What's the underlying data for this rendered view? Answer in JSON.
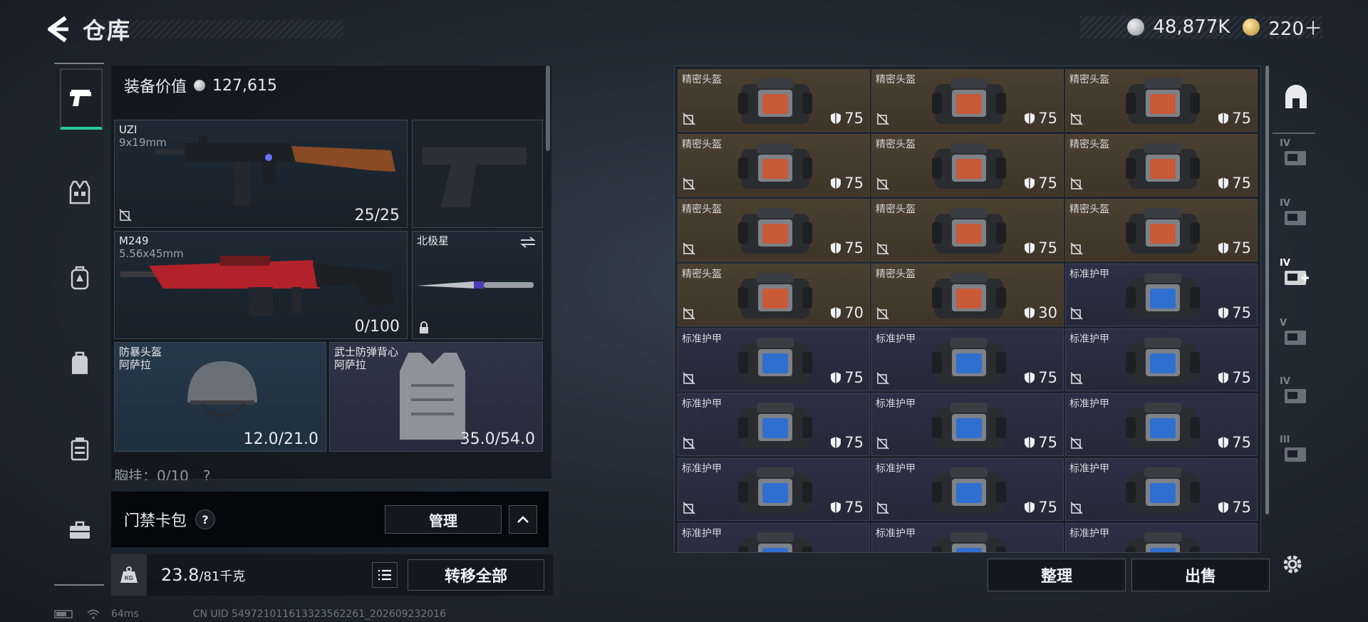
{
  "header": {
    "title": "仓库",
    "currency_primary": "48,877K",
    "currency_secondary": "220＋"
  },
  "left_nav": {
    "items": [
      {
        "icon": "pistol-icon",
        "active": true
      },
      {
        "icon": "vest-icon",
        "active": false
      },
      {
        "icon": "backpack-icon",
        "active": false
      },
      {
        "icon": "bag-icon",
        "active": false
      },
      {
        "icon": "canister-icon",
        "active": false
      },
      {
        "icon": "toolbox-icon",
        "active": false
      }
    ]
  },
  "equipment": {
    "value_label": "装备价值",
    "value": "127,615",
    "primary_weapon": {
      "name": "UZI",
      "caliber": "9x19mm",
      "ammo": "25/25"
    },
    "secondary_weapon": {
      "name": "M249",
      "caliber": "5.56x45mm",
      "ammo": "0/100"
    },
    "melee": {
      "name": "北极星"
    },
    "helmet": {
      "name": "防暴头盔",
      "brand": "阿萨拉",
      "durability": "12.0/21.0"
    },
    "armor": {
      "name": "武士防弹背心",
      "brand": "阿萨拉",
      "durability": "35.0/54.0"
    },
    "chest_rig": "胸挂：0/10　?"
  },
  "keycard": {
    "label": "门禁卡包",
    "help": "?",
    "manage_label": "管理"
  },
  "bottom_bar": {
    "weight_current": "23.8",
    "weight_max": "/81千克",
    "transfer_all_label": "转移全部"
  },
  "storage": {
    "items": [
      {
        "type": "helmet",
        "name": "精密头盔",
        "durability": "75"
      },
      {
        "type": "helmet",
        "name": "精密头盔",
        "durability": "75"
      },
      {
        "type": "helmet",
        "name": "精密头盔",
        "durability": "75"
      },
      {
        "type": "helmet",
        "name": "精密头盔",
        "durability": "75"
      },
      {
        "type": "helmet",
        "name": "精密头盔",
        "durability": "75"
      },
      {
        "type": "helmet",
        "name": "精密头盔",
        "durability": "75"
      },
      {
        "type": "helmet",
        "name": "精密头盔",
        "durability": "75"
      },
      {
        "type": "helmet",
        "name": "精密头盔",
        "durability": "75"
      },
      {
        "type": "helmet",
        "name": "精密头盔",
        "durability": "75"
      },
      {
        "type": "helmet",
        "name": "精密头盔",
        "durability": "70"
      },
      {
        "type": "helmet",
        "name": "精密头盔",
        "durability": "30"
      },
      {
        "type": "armor",
        "name": "标准护甲",
        "durability": "75"
      },
      {
        "type": "armor",
        "name": "标准护甲",
        "durability": "75"
      },
      {
        "type": "armor",
        "name": "标准护甲",
        "durability": "75"
      },
      {
        "type": "armor",
        "name": "标准护甲",
        "durability": "75"
      },
      {
        "type": "armor",
        "name": "标准护甲",
        "durability": "75"
      },
      {
        "type": "armor",
        "name": "标准护甲",
        "durability": "75"
      },
      {
        "type": "armor",
        "name": "标准护甲",
        "durability": "75"
      },
      {
        "type": "armor",
        "name": "标准护甲",
        "durability": "75"
      },
      {
        "type": "armor",
        "name": "标准护甲",
        "durability": "75"
      },
      {
        "type": "armor",
        "name": "标准护甲",
        "durability": "75"
      },
      {
        "type": "armor",
        "name": "标准护甲",
        "durability": ""
      },
      {
        "type": "armor",
        "name": "标准护甲",
        "durability": ""
      },
      {
        "type": "armor",
        "name": "标准护甲",
        "durability": ""
      }
    ],
    "organize_label": "整理",
    "sell_label": "出售"
  },
  "right_nav": {
    "items": [
      {
        "icon": "helmet-category-icon"
      },
      {
        "icon": "tier-4-case-icon",
        "text": "IV"
      },
      {
        "icon": "tier-4-case-icon",
        "text": "IV"
      },
      {
        "icon": "add-case-icon",
        "text": "IV",
        "active": true
      },
      {
        "icon": "tier-5-key-icon",
        "text": "V"
      },
      {
        "icon": "tier-4-key-icon",
        "text": "IV"
      },
      {
        "icon": "tier-3-case-icon",
        "text": "III"
      }
    ]
  },
  "status": {
    "ping": "64ms",
    "uid": "CN UID 549721011613323562261_202609232016"
  },
  "colors": {
    "accent": "#27c8a0",
    "helmet_cell": "#4b4030",
    "armor_cell": "#2d2f45"
  }
}
